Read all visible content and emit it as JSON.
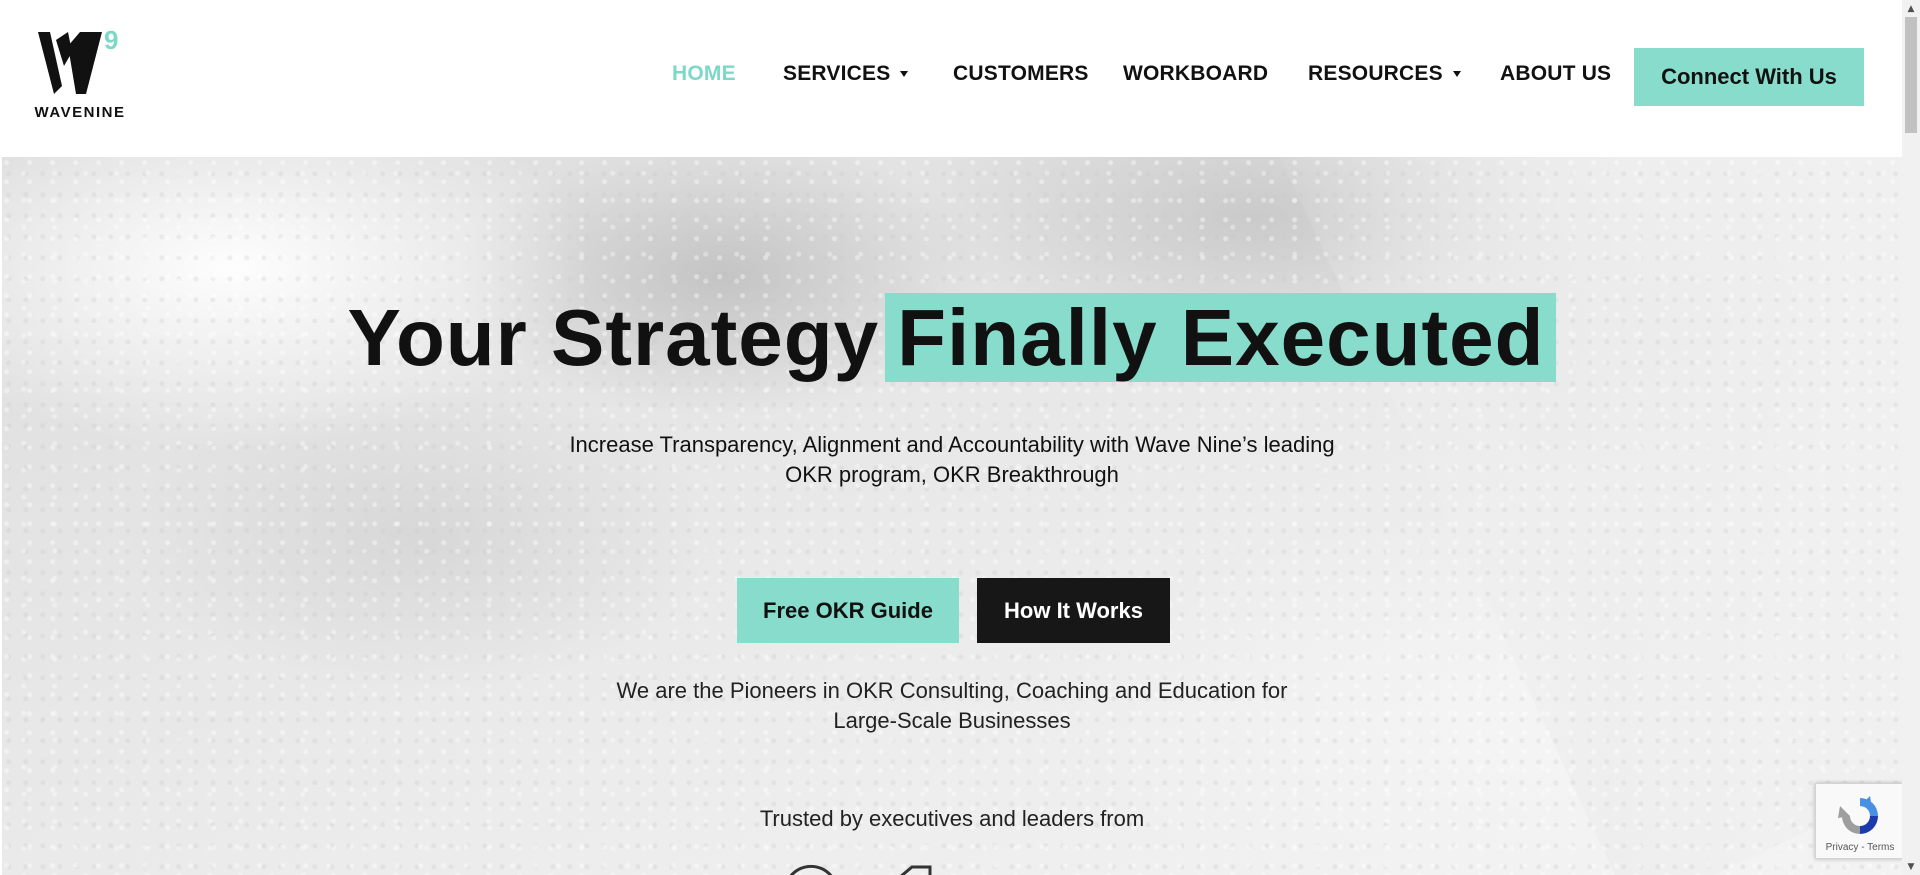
{
  "brand": {
    "name": "WAVENINE",
    "logo_mark": "W9 logo",
    "accent_color": "#87dccc",
    "active_nav_color": "#7ed8c8"
  },
  "nav": {
    "items": [
      {
        "label": "HOME",
        "active": true,
        "dropdown": false
      },
      {
        "label": "SERVICES",
        "active": false,
        "dropdown": true
      },
      {
        "label": "CUSTOMERS",
        "active": false,
        "dropdown": false
      },
      {
        "label": "WORKBOARD",
        "active": false,
        "dropdown": false
      },
      {
        "label": "RESOURCES",
        "active": false,
        "dropdown": true
      },
      {
        "label": "ABOUT US",
        "active": false,
        "dropdown": false
      }
    ],
    "cta_label": "Connect With Us"
  },
  "hero": {
    "headline_plain": "Your Strategy",
    "headline_highlight": "Finally Executed",
    "subheadline_line1": "Increase Transparency, Alignment and Accountability with Wave Nine’s leading",
    "subheadline_line2": "OKR program, OKR Breakthrough",
    "primary_button": "Free OKR Guide",
    "secondary_button": "How It Works",
    "pioneers_line1": "We are the Pioneers in OKR Consulting, Coaching and Education for",
    "pioneers_line2": "Large-Scale Businesses",
    "trusted_text": "Trusted by executives and leaders from"
  },
  "recaptcha": {
    "privacy": "Privacy",
    "separator": " - ",
    "terms": "Terms"
  },
  "scrollbar": {
    "up_glyph": "▲",
    "down_glyph": "▼"
  }
}
